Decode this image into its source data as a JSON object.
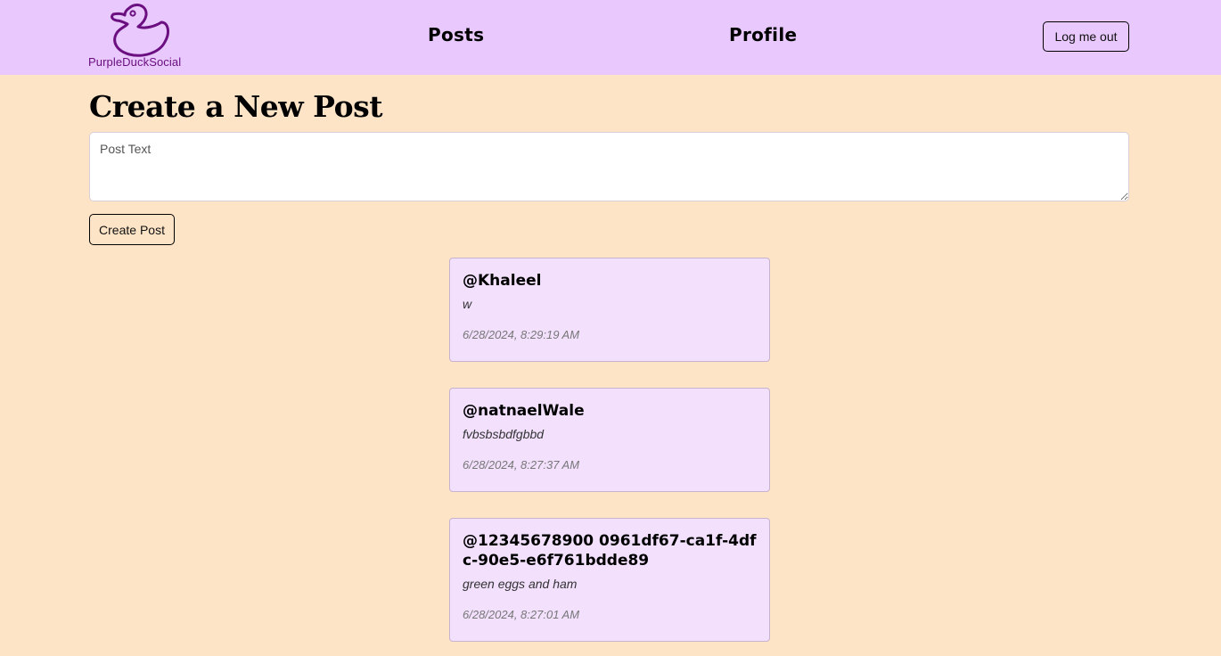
{
  "header": {
    "brand_name": "PurpleDuckSocial",
    "nav_posts": "Posts",
    "nav_profile": "Profile",
    "logout_label": "Log me out"
  },
  "create_post": {
    "title": "Create a New Post",
    "placeholder": "Post Text",
    "button_label": "Create Post"
  },
  "posts": [
    {
      "author": "@Khaleel",
      "text": "w",
      "timestamp": "6/28/2024, 8:29:19 AM"
    },
    {
      "author": "@natnaelWale",
      "text": "fvbsbsbdfgbbd",
      "timestamp": "6/28/2024, 8:27:37 AM"
    },
    {
      "author": "@12345678900 0961df67-ca1f-4dfc-90e5-e6f761bdde89",
      "text": "green eggs and ham",
      "timestamp": "6/28/2024, 8:27:01 AM"
    }
  ],
  "colors": {
    "header_bg": "#e8c8fd",
    "page_bg": "#fde4c7",
    "card_bg": "#f2e0fd",
    "brand": "#6b0f80"
  },
  "icons": {
    "logo": "duck-icon"
  }
}
